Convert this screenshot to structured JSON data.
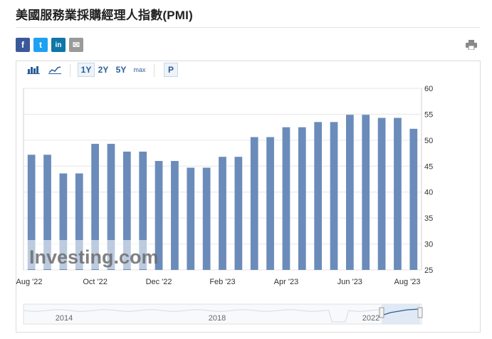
{
  "page": {
    "title": "美國服務業採購經理人指數(PMI)"
  },
  "share": {
    "facebook_label": "f",
    "twitter_label": "t",
    "linkedin_label": "in",
    "email_label": "✉"
  },
  "toolbar": {
    "range_1y": "1Y",
    "range_2y": "2Y",
    "range_5y": "5Y",
    "range_max": "max",
    "p_label": "P"
  },
  "watermark": "Investing.com",
  "colors": {
    "bar": "#6b8cba",
    "grid": "#e6e6e6",
    "axis_text": "#333333",
    "navigator_fill": "#dbe6f3",
    "navigator_line": "#9fb7d6"
  },
  "chart_data": {
    "type": "bar",
    "title": "",
    "xlabel": "",
    "ylabel": "",
    "ylim": [
      25,
      60
    ],
    "yticks": [
      25,
      30,
      35,
      40,
      45,
      50,
      55,
      60
    ],
    "x_tick_labels": [
      "Aug '22",
      "Oct '22",
      "Dec '22",
      "Feb '23",
      "Apr '23",
      "Jun '23",
      "Aug '23"
    ],
    "categories": [
      "2022-08-a",
      "2022-08-b",
      "2022-09-a",
      "2022-09-b",
      "2022-10-a",
      "2022-10-b",
      "2022-11-a",
      "2022-11-b",
      "2022-12-a",
      "2022-12-b",
      "2023-01-a",
      "2023-01-b",
      "2023-02-a",
      "2023-02-b",
      "2023-03-a",
      "2023-03-b",
      "2023-04-a",
      "2023-04-b",
      "2023-05-a",
      "2023-05-b",
      "2023-06-a",
      "2023-06-b",
      "2023-07-a",
      "2023-07-b",
      "2023-08-a"
    ],
    "values": [
      47.2,
      47.2,
      43.6,
      43.6,
      49.3,
      49.3,
      47.8,
      47.8,
      46.0,
      46.0,
      44.7,
      44.7,
      46.8,
      46.8,
      50.6,
      50.6,
      52.5,
      52.5,
      53.5,
      53.5,
      54.9,
      54.9,
      54.3,
      54.3,
      52.2
    ],
    "grid": true,
    "y_axis_position": "right",
    "navigator": {
      "tick_labels": [
        "2014",
        "2018",
        "2022"
      ]
    }
  }
}
